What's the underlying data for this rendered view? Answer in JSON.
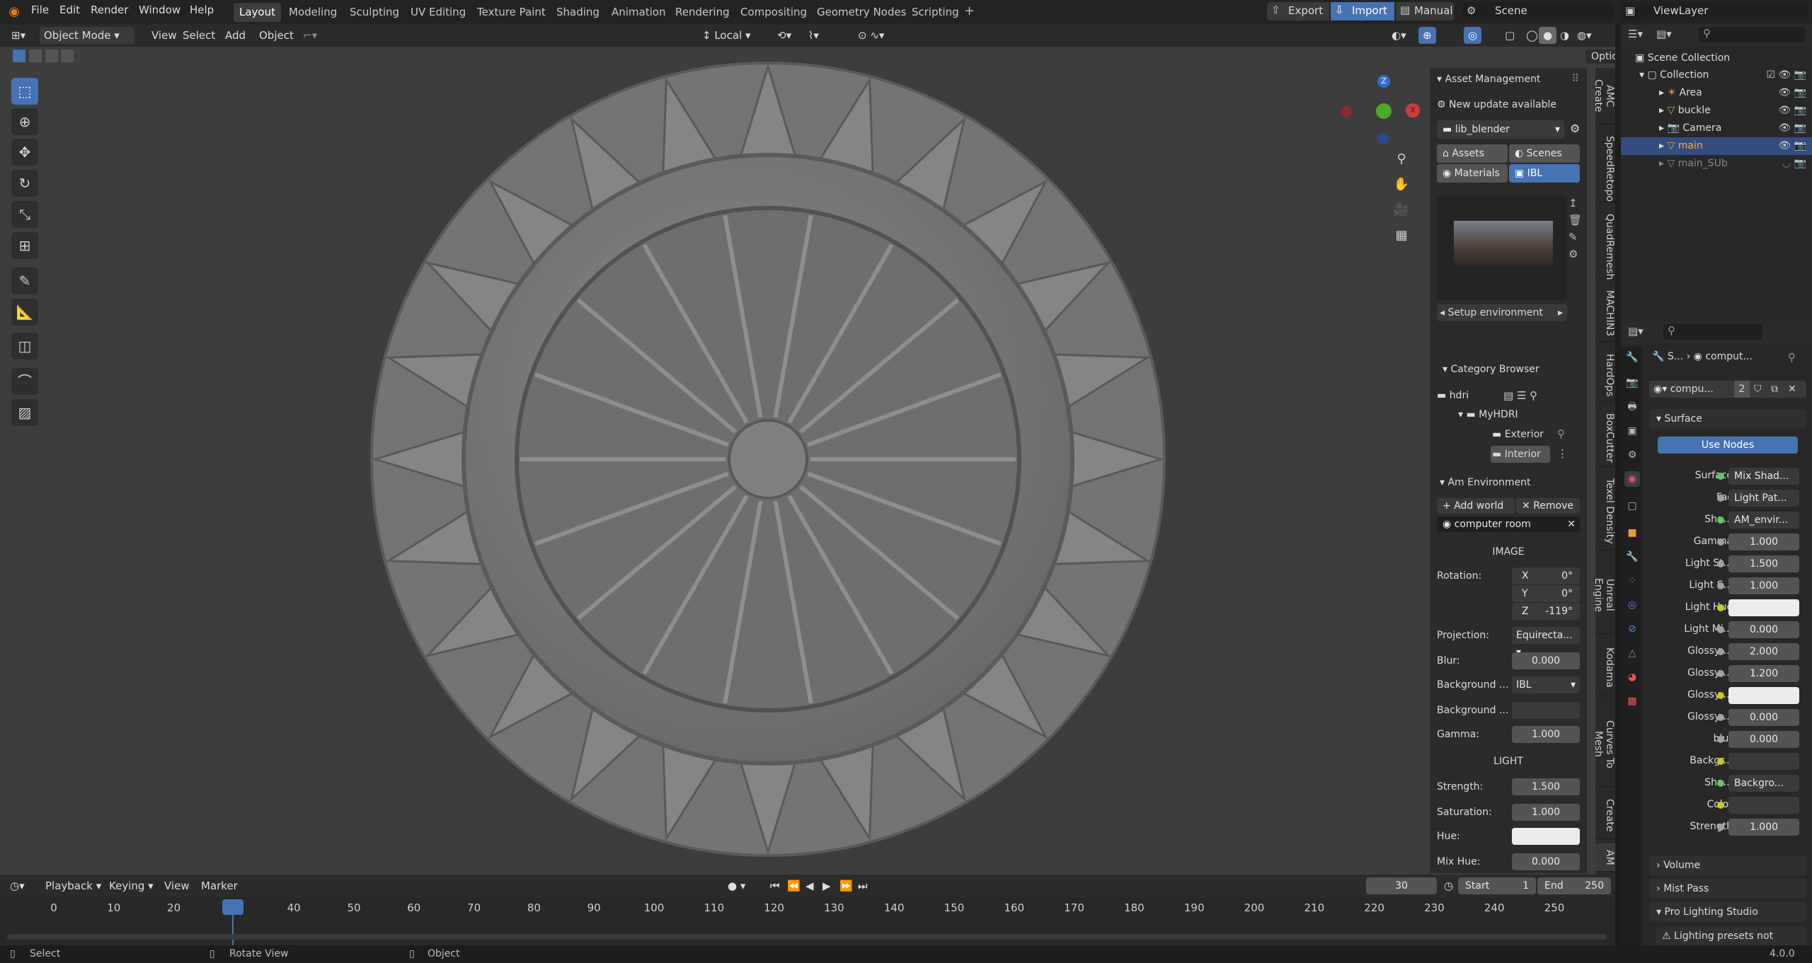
{
  "topbar": {
    "menus": [
      "File",
      "Edit",
      "Render",
      "Window",
      "Help"
    ],
    "workspaces": [
      "Layout",
      "Modeling",
      "Sculpting",
      "UV Editing",
      "Texture Paint",
      "Shading",
      "Animation",
      "Rendering",
      "Compositing",
      "Geometry Nodes",
      "Scripting"
    ],
    "active_workspace": "Layout",
    "export_label": "Export",
    "import_label": "Import",
    "manual_label": "Manual",
    "scene": "Scene",
    "view_layer": "ViewLayer"
  },
  "header3d": {
    "mode": "Object Mode",
    "menus": [
      "View",
      "Select",
      "Add",
      "Object"
    ],
    "orientation": "Local",
    "options": "Options"
  },
  "npanel": {
    "title": "Asset Management",
    "update_notice": "New update available",
    "library": "lib_blender",
    "tabs": {
      "assets": "Assets",
      "scenes": "Scenes",
      "materials": "Materials",
      "ibl": "IBL"
    },
    "setup_env": "Setup environment",
    "category_browser": "Category Browser",
    "tree": {
      "root": "hdri",
      "folder": "MyHDRI",
      "child1": "Exterior",
      "child2": "Interior"
    },
    "am_env": "Am Environment",
    "add_world": "Add world",
    "remove": "Remove",
    "world_name": "computer room",
    "image_header": "IMAGE",
    "rotation_label": "Rotation:",
    "rot_x": "0°",
    "rot_y": "0°",
    "rot_z": "-119°",
    "projection_label": "Projection:",
    "projection": "Equirecta...",
    "blur_label": "Blur:",
    "blur": "0.000",
    "bg_label": "Background ...",
    "bg_value": "IBL",
    "bg2_label": "Background ...",
    "gamma_label": "Gamma:",
    "gamma": "1.000",
    "light_header": "LIGHT",
    "strength_label": "Strength:",
    "strength": "1.500",
    "saturation_label": "Saturation:",
    "saturation": "1.000",
    "hue_label": "Hue:",
    "mixhue_label": "Mix Hue:",
    "mixhue": "0.000"
  },
  "sidetabs": [
    "AMC Create",
    "SpeedRetopo",
    "QuadRemesh",
    "MACHIN3",
    "HardOps",
    "BoxCutter",
    "Texel Density",
    "Unreal Engine",
    "Kodama",
    "Curves To Mesh",
    "Create",
    "AM"
  ],
  "outliner": {
    "root": "Scene Collection",
    "collection": "Collection",
    "items": [
      "Area",
      "buckle",
      "Camera",
      "main",
      "main_SUb"
    ],
    "selected": "main"
  },
  "props": {
    "breadcrumb1": "S...",
    "breadcrumb2": "comput...",
    "world_field": "compu...",
    "users": "2",
    "surface_header": "Surface",
    "use_nodes": "Use Nodes",
    "rows": [
      {
        "label": "Surface",
        "value": "Mix Shad...",
        "color": "#63c763",
        "link": true
      },
      {
        "label": "Fac",
        "value": "Light Pat...",
        "color": "#a1a1a1",
        "link": true
      },
      {
        "label": "Sha...",
        "value": "AM_envir...",
        "color": "#63c763",
        "link": true
      },
      {
        "label": "Gamma",
        "value": "1.000",
        "color": "#a1a1a1",
        "link": false
      },
      {
        "label": "Light St...",
        "value": "1.500",
        "color": "#a1a1a1",
        "link": false
      },
      {
        "label": "Light S...",
        "value": "1.000",
        "color": "#a1a1a1",
        "link": false
      },
      {
        "label": "Light Hue",
        "value": "",
        "color": "#c7c729",
        "link": false
      },
      {
        "label": "Light Mi...",
        "value": "0.000",
        "color": "#a1a1a1",
        "link": false
      },
      {
        "label": "Glossy ...",
        "value": "2.000",
        "color": "#a1a1a1",
        "link": false
      },
      {
        "label": "Glossy ...",
        "value": "1.200",
        "color": "#a1a1a1",
        "link": false
      },
      {
        "label": "Glossy ...",
        "value": "",
        "color": "#c7c729",
        "link": false
      },
      {
        "label": "Glossy ...",
        "value": "0.000",
        "color": "#a1a1a1",
        "link": false
      },
      {
        "label": "blur",
        "value": "0.000",
        "color": "#a1a1a1",
        "link": false
      },
      {
        "label": "Backgr...",
        "value": "",
        "color": "#c7c729",
        "link": true
      },
      {
        "label": "Sha...",
        "value": "Backgro...",
        "color": "#63c763",
        "link": true
      },
      {
        "label": "Color",
        "value": "",
        "color": "#c7c729",
        "link": true
      },
      {
        "label": "Strength",
        "value": "1.000",
        "color": "#a1a1a1",
        "link": false
      }
    ],
    "volume": "Volume",
    "mist": "Mist Pass",
    "prolighting": "Pro Lighting Studio",
    "warning": "Lighting presets not"
  },
  "timeline": {
    "menus": [
      "Playback",
      "Keying",
      "View",
      "Marker"
    ],
    "current": "30",
    "start_label": "Start",
    "start": "1",
    "end_label": "End",
    "end": "250",
    "ticks": [
      "0",
      "10",
      "20",
      "30",
      "40",
      "50",
      "60",
      "70",
      "80",
      "90",
      "100",
      "110",
      "120",
      "130",
      "140",
      "150",
      "160",
      "170",
      "180",
      "190",
      "200",
      "210",
      "220",
      "230",
      "240",
      "250"
    ]
  },
  "status": {
    "select": "Select",
    "rotate": "Rotate View",
    "object": "Object",
    "version": "4.0.0"
  }
}
